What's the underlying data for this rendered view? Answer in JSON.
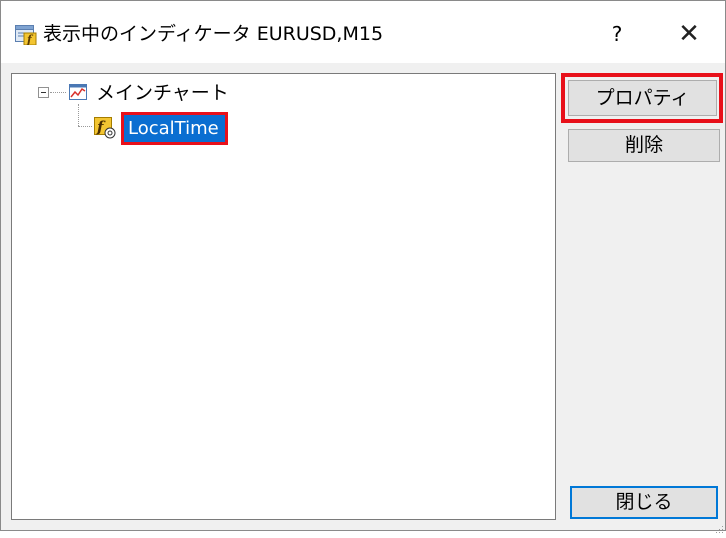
{
  "window": {
    "title": "表示中のインディケータ EURUSD,M15",
    "help_label": "?",
    "close_label": "✕"
  },
  "tree": {
    "root": {
      "label": "メインチャート",
      "icon": "chart-icon"
    },
    "child": {
      "label": "LocalTime",
      "icon": "indicator-icon",
      "selected": true
    }
  },
  "buttons": {
    "properties": "プロパティ",
    "delete": "削除",
    "close": "閉じる"
  },
  "colors": {
    "selection": "#0a6ed1",
    "highlight_box": "#e8101a",
    "default_button_border": "#0078d7"
  }
}
